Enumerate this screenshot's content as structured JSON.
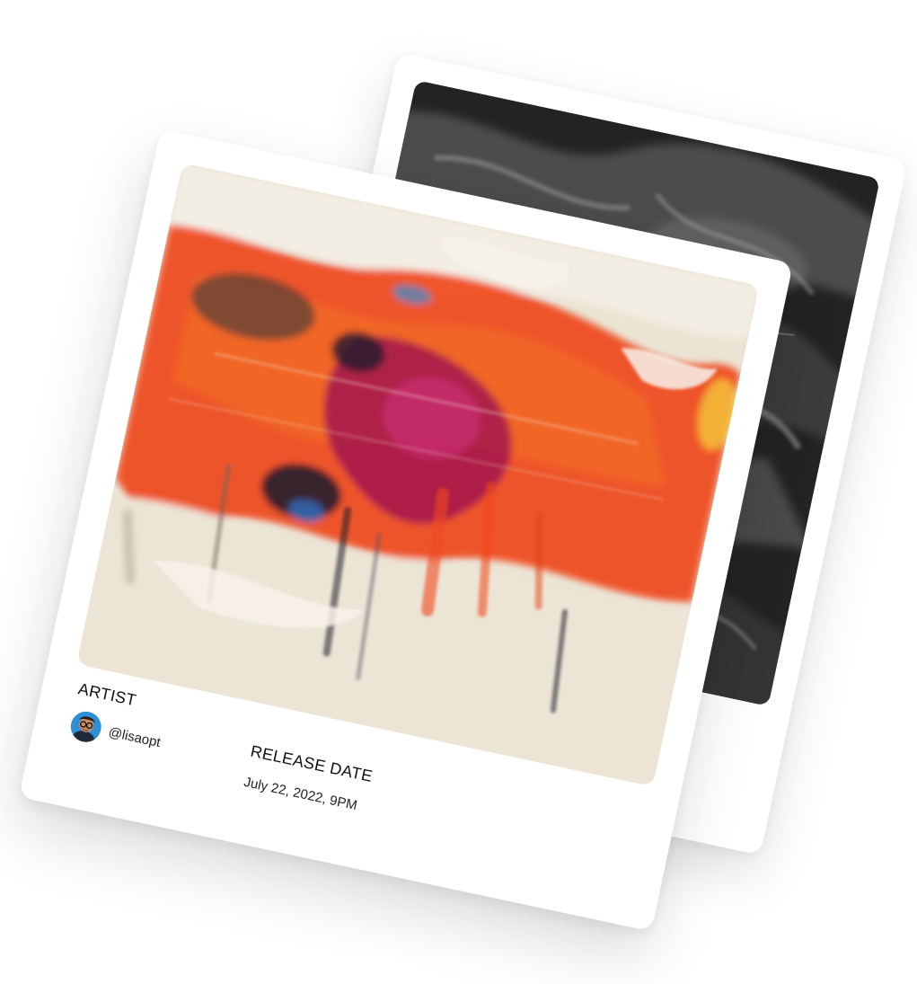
{
  "artist": {
    "label": "ARTIST",
    "handle": "@lisaopt",
    "avatar_icon": "avatar-portrait"
  },
  "release": {
    "label": "RELEASE DATE",
    "value": "July 22, 2022, 9PM"
  },
  "artwork": {
    "front": "abstract-red-orange-impasto-painting",
    "back": "abstract-black-and-white-painting"
  },
  "colors": {
    "card_background": "#ffffff",
    "front_primary": "#f0431a",
    "front_magenta": "#a3164d",
    "front_cream": "#ece5d6",
    "back_dark": "#262626",
    "avatar_blue": "#2f8fd6"
  }
}
